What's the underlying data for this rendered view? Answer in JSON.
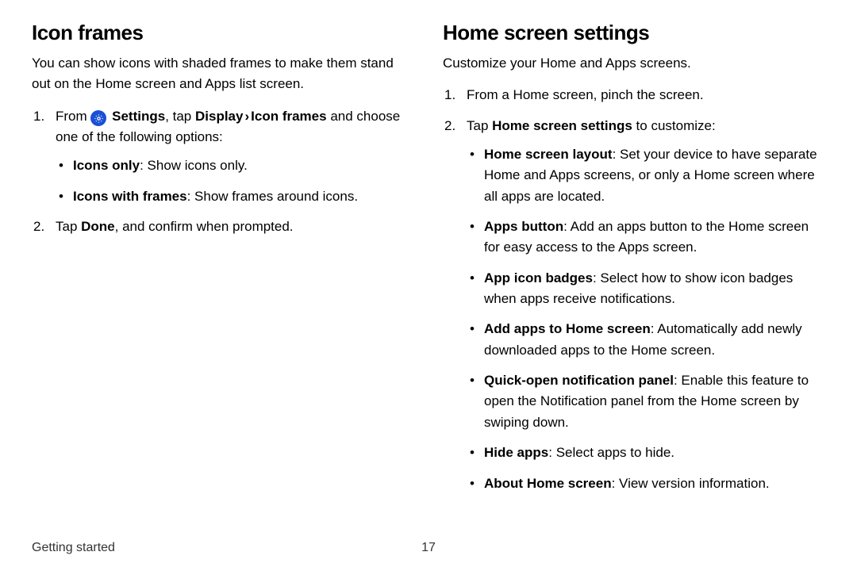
{
  "left": {
    "heading": "Icon frames",
    "intro": "You can show icons with shaded frames to make them stand out on the Home screen and Apps list screen.",
    "step1_from": "From ",
    "step1_settings": "Settings",
    "step1_tap": ", tap ",
    "step1_display": "Display",
    "step1_icon_frames": "Icon frames",
    "step1_tail": " and choose one of the following options:",
    "opt1_b": "Icons only",
    "opt1_t": ": Show icons only.",
    "opt2_b": "Icons with frames",
    "opt2_t": ": Show frames around icons.",
    "step2_a": "Tap ",
    "step2_b": "Done",
    "step2_c": ", and confirm when prompted."
  },
  "right": {
    "heading": "Home screen settings",
    "intro": "Customize your Home and Apps screens.",
    "step1": "From a Home screen, pinch the screen.",
    "step2_a": "Tap ",
    "step2_b": "Home screen settings",
    "step2_c": " to customize:",
    "b1_b": "Home screen layout",
    "b1_t": ": Set your device to have separate Home and Apps screens, or only a Home screen where all apps are located.",
    "b2_b": "Apps button",
    "b2_t": ": Add an apps button to the Home screen for easy access to the Apps screen.",
    "b3_b": "App icon badges",
    "b3_t": ": Select how to show icon badges when apps receive notifications.",
    "b4_b": "Add apps to Home screen",
    "b4_t": ": Automatically add newly downloaded apps to the Home screen.",
    "b5_b": "Quick-open notification panel",
    "b5_t": ": Enable this feature to open the Notification panel from the Home screen by swiping down.",
    "b6_b": "Hide apps",
    "b6_t": ": Select apps to hide.",
    "b7_b": "About Home screen",
    "b7_t": ": View version information."
  },
  "footer": {
    "section": "Getting started",
    "page": "17"
  }
}
